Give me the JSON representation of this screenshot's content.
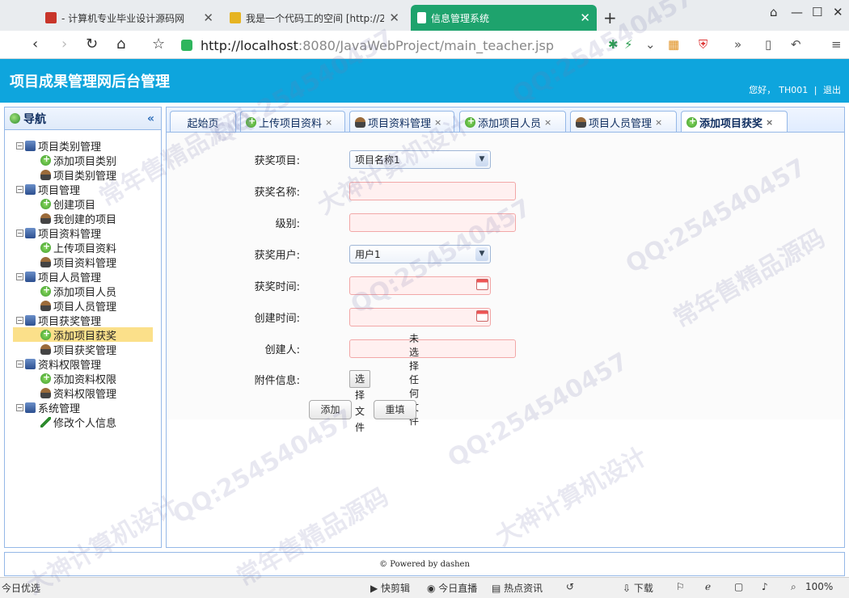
{
  "browser": {
    "tabs": [
      {
        "title": "- 计算机专业毕业设计源码网",
        "color": "#c8352a",
        "active": false
      },
      {
        "title": "我是一个代码工的空间 [http://2",
        "color": "#e6b422",
        "active": false
      },
      {
        "title": "信息管理系统",
        "color": "#ffffff",
        "active": true
      }
    ],
    "new_tab": "+",
    "url_host": "http://localhost",
    "url_rest": ":8080/JavaWebProject/main_teacher.jsp",
    "window_controls": [
      "⌂",
      "—",
      "☐",
      "✕"
    ]
  },
  "app": {
    "title": "项目成果管理网后台管理",
    "greeting": "您好，",
    "username": "TH001",
    "separator": "|",
    "logout": "退出"
  },
  "nav": {
    "header": "导航",
    "collapse": "«",
    "groups": [
      {
        "label": "项目类别管理",
        "items": [
          {
            "label": "添加项目类别",
            "icon": "add-icon"
          },
          {
            "label": "项目类别管理",
            "icon": "user-icon"
          }
        ]
      },
      {
        "label": "项目管理",
        "items": [
          {
            "label": "创建项目",
            "icon": "add-icon"
          },
          {
            "label": "我创建的项目",
            "icon": "user-icon"
          }
        ]
      },
      {
        "label": "项目资料管理",
        "items": [
          {
            "label": "上传项目资料",
            "icon": "add-icon"
          },
          {
            "label": "项目资料管理",
            "icon": "user-icon"
          }
        ]
      },
      {
        "label": "项目人员管理",
        "items": [
          {
            "label": "添加项目人员",
            "icon": "add-icon"
          },
          {
            "label": "项目人员管理",
            "icon": "user-icon"
          }
        ]
      },
      {
        "label": "项目获奖管理",
        "items": [
          {
            "label": "添加项目获奖",
            "icon": "add-icon"
          },
          {
            "label": "项目获奖管理",
            "icon": "user-icon"
          }
        ]
      },
      {
        "label": "资料权限管理",
        "items": [
          {
            "label": "添加资料权限",
            "icon": "add-icon"
          },
          {
            "label": "资料权限管理",
            "icon": "user-icon"
          }
        ]
      },
      {
        "label": "系统管理",
        "items": [
          {
            "label": "修改个人信息",
            "icon": "pen-icon"
          }
        ]
      }
    ],
    "selected": "添加项目获奖"
  },
  "tabs": [
    {
      "label": "起始页",
      "closable": false
    },
    {
      "label": "上传项目资料",
      "closable": true
    },
    {
      "label": "项目资料管理",
      "closable": true
    },
    {
      "label": "添加项目人员",
      "closable": true
    },
    {
      "label": "项目人员管理",
      "closable": true
    },
    {
      "label": "添加项目获奖",
      "closable": true,
      "active": true
    }
  ],
  "form": {
    "project_label": "获奖项目:",
    "project_value": "项目名称1",
    "award_name_label": "获奖名称:",
    "level_label": "级别:",
    "award_user_label": "获奖用户:",
    "award_user_value": "用户1",
    "award_time_label": "获奖时间:",
    "create_time_label": "创建时间:",
    "creator_label": "创建人:",
    "attachment_label": "附件信息:",
    "file_button": "选择文件",
    "file_status": "未选择任何文件",
    "submit": "添加",
    "reset": "重填"
  },
  "footer": {
    "text": "© Powered by dashen"
  },
  "statusbar": {
    "left": "今日优选",
    "items": [
      "快剪辑",
      "今日直播",
      "热点资讯",
      "下载"
    ],
    "zoom": "100%"
  },
  "watermarks": [
    "QQ:254540457",
    "常年售精品源码",
    "大神计算机设计"
  ]
}
